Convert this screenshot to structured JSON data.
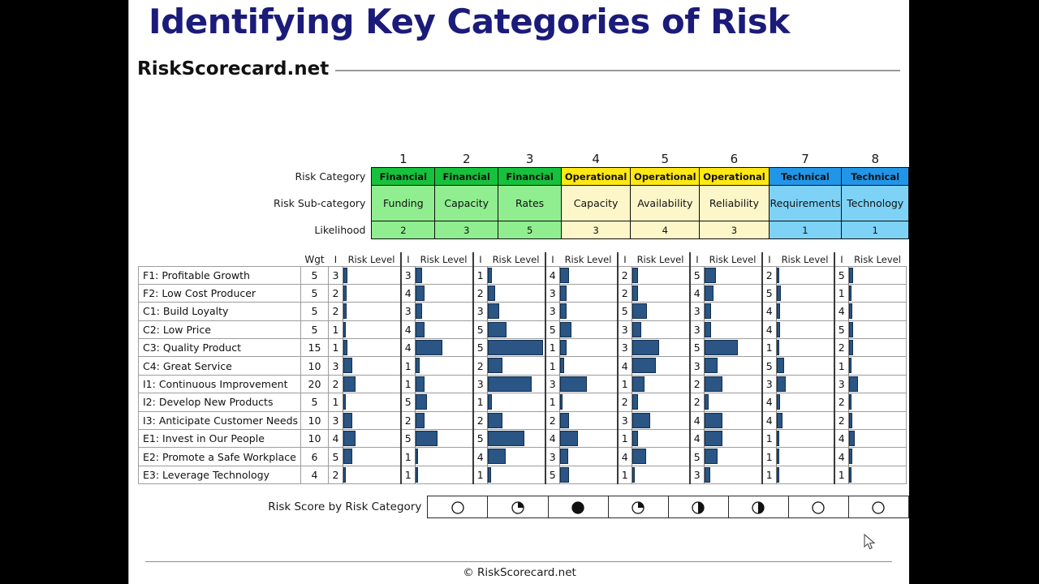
{
  "slide": {
    "title": "Identifying Key Categories of Risk",
    "brand": "RiskScorecard.net",
    "footer": "© RiskScorecard.net"
  },
  "matrix": {
    "row_labels": {
      "risk_category": "Risk Category",
      "risk_subcategory": "Risk Sub-category",
      "likelihood": "Likelihood",
      "score_by_category": "Risk Score by Risk Category"
    },
    "column_headers": {
      "objective": "",
      "weight": "Wgt",
      "impact": "I",
      "risk_level": "Risk Level"
    },
    "column_numbers": [
      "1",
      "2",
      "3",
      "4",
      "5",
      "6",
      "7",
      "8"
    ],
    "categories": [
      "Financial",
      "Financial",
      "Financial",
      "Operational",
      "Operational",
      "Operational",
      "Technical",
      "Technical"
    ],
    "subcategories": [
      "Funding",
      "Capacity",
      "Rates",
      "Capacity",
      "Availability",
      "Reliability",
      "Requirements",
      "Technology"
    ],
    "likelihood": [
      2,
      3,
      5,
      3,
      4,
      3,
      1,
      1
    ],
    "category_colors": {
      "Financial": "#16c13c",
      "Operational": "#ffe814",
      "Technical": "#2196e8"
    },
    "bar_color": "#2a5584",
    "objectives": [
      "F1: Profitable Growth",
      "F2: Low Cost Producer",
      "C1: Build Loyalty",
      "C2: Low Price",
      "C3: Quality Product",
      "C4: Great Service",
      "I1: Continuous Improvement",
      "I2: Develop New Products",
      "I3: Anticipate Customer Needs",
      "E1: Invest in Our People",
      "E2: Promote a Safe Workplace",
      "E3: Leverage Technology"
    ],
    "weights": [
      5,
      5,
      5,
      5,
      15,
      10,
      20,
      5,
      10,
      10,
      6,
      4
    ],
    "impacts": [
      [
        3,
        3,
        1,
        4,
        2,
        5,
        2,
        5
      ],
      [
        2,
        4,
        2,
        3,
        2,
        4,
        5,
        1
      ],
      [
        2,
        3,
        3,
        3,
        5,
        3,
        4,
        4
      ],
      [
        1,
        4,
        5,
        5,
        3,
        3,
        4,
        5
      ],
      [
        1,
        4,
        5,
        1,
        3,
        5,
        1,
        2
      ],
      [
        3,
        1,
        2,
        1,
        4,
        3,
        5,
        1
      ],
      [
        2,
        1,
        3,
        3,
        1,
        2,
        3,
        3
      ],
      [
        1,
        5,
        1,
        1,
        2,
        2,
        4,
        2
      ],
      [
        3,
        2,
        2,
        2,
        3,
        4,
        4,
        2
      ],
      [
        4,
        5,
        5,
        4,
        1,
        4,
        1,
        4
      ],
      [
        5,
        1,
        4,
        3,
        4,
        5,
        1,
        4
      ],
      [
        2,
        1,
        1,
        5,
        1,
        3,
        1,
        1
      ]
    ],
    "risk_score_by_category": [
      {
        "column": "1",
        "symbol": "empty-circle",
        "fill": 0
      },
      {
        "column": "2",
        "symbol": "quarter-circle",
        "fill": 25
      },
      {
        "column": "3",
        "symbol": "full-circle",
        "fill": 100
      },
      {
        "column": "4",
        "symbol": "quarter-circle",
        "fill": 25
      },
      {
        "column": "5",
        "symbol": "half-circle",
        "fill": 50
      },
      {
        "column": "6",
        "symbol": "half-circle",
        "fill": 50
      },
      {
        "column": "7",
        "symbol": "empty-circle",
        "fill": 0
      },
      {
        "column": "8",
        "symbol": "empty-circle",
        "fill": 0
      }
    ]
  }
}
